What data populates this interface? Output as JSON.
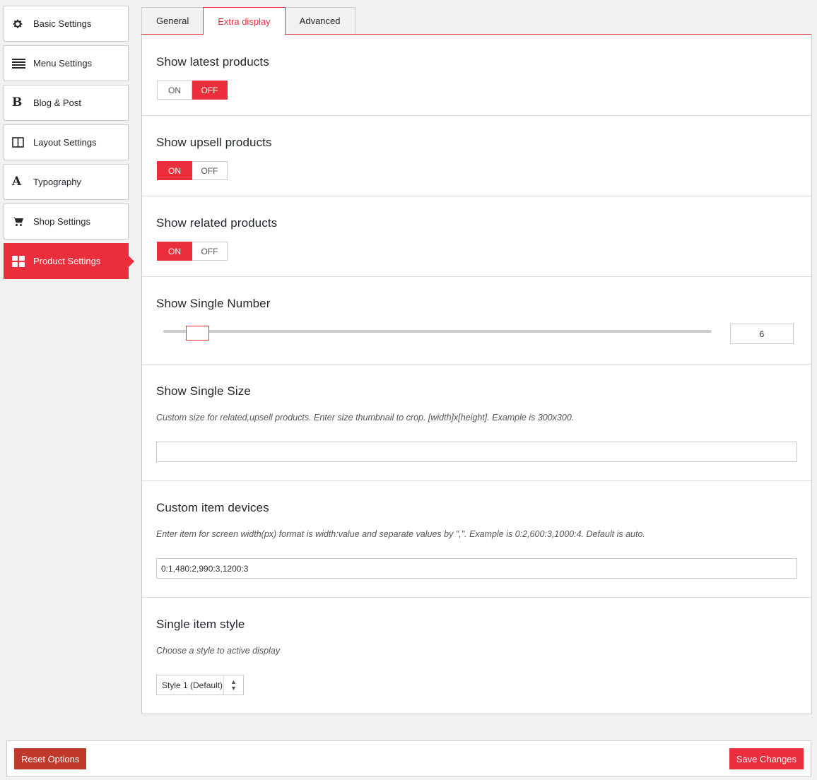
{
  "sidebar": {
    "items": [
      {
        "label": "Basic Settings",
        "icon": "gear-icon"
      },
      {
        "label": "Menu Settings",
        "icon": "menu-lines-icon"
      },
      {
        "label": "Blog & Post",
        "icon": "bold-b-icon",
        "glyph": "B"
      },
      {
        "label": "Layout Settings",
        "icon": "columns-icon"
      },
      {
        "label": "Typography",
        "icon": "letter-a-icon",
        "glyph": "A"
      },
      {
        "label": "Shop Settings",
        "icon": "cart-icon"
      },
      {
        "label": "Product Settings",
        "icon": "grid-icon",
        "active": true
      }
    ]
  },
  "tabs": [
    {
      "label": "General"
    },
    {
      "label": "Extra display",
      "active": true
    },
    {
      "label": "Advanced"
    }
  ],
  "sections": {
    "latest": {
      "title": "Show latest products",
      "on_label": "ON",
      "off_label": "OFF",
      "value": "OFF"
    },
    "upsell": {
      "title": "Show upsell products",
      "on_label": "ON",
      "off_label": "OFF",
      "value": "ON"
    },
    "related": {
      "title": "Show related products",
      "on_label": "ON",
      "off_label": "OFF",
      "value": "ON"
    },
    "single_number": {
      "title": "Show Single Number",
      "value": "6"
    },
    "single_size": {
      "title": "Show Single Size",
      "description": "Custom size for related,upsell products. Enter size thumbnail to crop. [width]x[height]. Example is 300x300.",
      "value": ""
    },
    "item_devices": {
      "title": "Custom item devices",
      "description": "Enter item for screen width(px) format is width:value and separate values by \",\". Example is 0:2,600:3,1000:4. Default is auto.",
      "value": "0:1,480:2,990:3,1200:3"
    },
    "item_style": {
      "title": "Single item style",
      "description": "Choose a style to active display",
      "selected": "Style 1 (Default)"
    }
  },
  "footer": {
    "reset_label": "Reset Options",
    "save_label": "Save Changes"
  },
  "colors": {
    "accent": "#ea2e3b",
    "reset": "#c0392b"
  }
}
